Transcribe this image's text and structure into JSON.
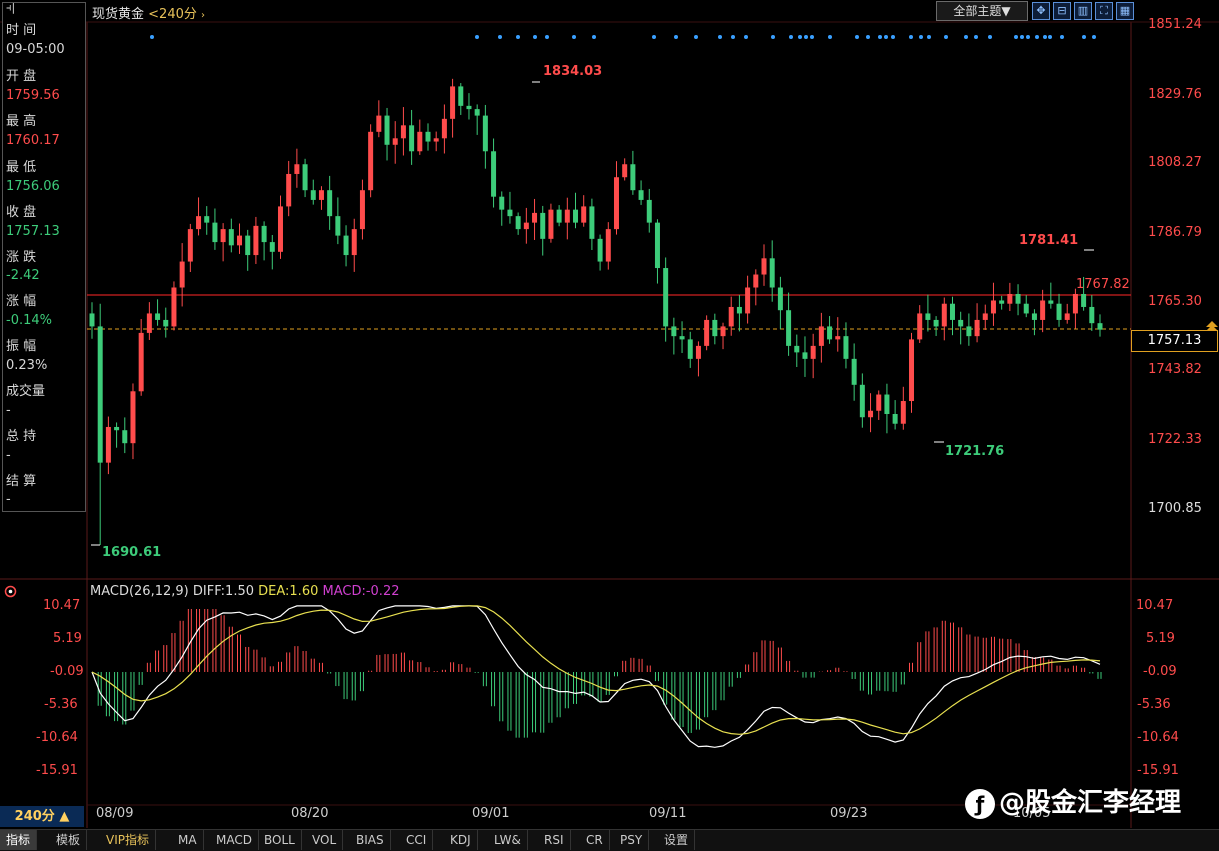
{
  "header": {
    "symbol": "现货黄金",
    "period": "<240分",
    "dropdown_arrow": "›",
    "theme_dropdown": "全部主题▼",
    "tools": [
      "move-icon",
      "chart-icon",
      "split-icon",
      "fullscreen-icon",
      "grid-icon"
    ]
  },
  "info_panel": {
    "time_label": "时 间",
    "time_value": "09-05:00",
    "open_label": "开 盘",
    "open_value": "1759.56",
    "high_label": "最 高",
    "high_value": "1760.17",
    "low_label": "最 低",
    "low_value": "1756.06",
    "close_label": "收 盘",
    "close_value": "1757.13",
    "change_label": "涨 跌",
    "change_value": "-2.42",
    "pct_label": "涨 幅",
    "pct_value": "-0.14%",
    "amp_label": "振 幅",
    "amp_value": "0.23%",
    "vol_label": "成交量",
    "vol_value": "-",
    "oi_label": "总 持",
    "oi_value": "-",
    "settle_label": "结 算",
    "settle_value": "-"
  },
  "price_axis": [
    "1851.24",
    "1829.76",
    "1808.27",
    "1786.79",
    "1765.30",
    "1743.82",
    "1722.33",
    "1700.85"
  ],
  "current_price": "1757.13",
  "annotations": {
    "high": "1834.03",
    "low_start": "1690.61",
    "low_mid": "1721.76",
    "recent_high": "1781.41",
    "red_line": "1767.82"
  },
  "macd": {
    "label": "MACD(26,12,9)",
    "diff": "DIFF:1.50",
    "dea": "DEA:1.60",
    "macd": "MACD:-0.22",
    "axis": [
      "10.47",
      "5.19",
      "-0.09",
      "-5.36",
      "-10.64",
      "-15.91"
    ]
  },
  "dates": [
    "08/09",
    "08/20",
    "09/01",
    "09/11",
    "09/23",
    "10/05"
  ],
  "period_button": "240分 ▲",
  "tabs": [
    "指标",
    "模板",
    "VIP指标",
    "MA",
    "MACD",
    "BOLL",
    "VOL",
    "BIAS",
    "CCI",
    "KDJ",
    "LW&",
    "RSI",
    "CR",
    "PSY",
    "设置"
  ],
  "watermark": "@股金汇李经理",
  "colors": {
    "up": "#ff4c4c",
    "down": "#3dcc7a",
    "dif": "#ffffff",
    "dea": "#e8e050"
  },
  "chart_data": {
    "type": "candlestick",
    "title": "现货黄金 240分",
    "ylim": [
      1690.61,
      1851.24
    ],
    "series": [
      {
        "name": "close",
        "values": [
          1758,
          1716,
          1727,
          1726,
          1722,
          1738,
          1756,
          1762,
          1760,
          1758,
          1770,
          1778,
          1788,
          1792,
          1790,
          1784,
          1788,
          1783,
          1786,
          1780,
          1789,
          1784,
          1781,
          1795,
          1805,
          1808,
          1800,
          1797,
          1800,
          1792,
          1786,
          1780,
          1788,
          1800,
          1818,
          1823,
          1814,
          1816,
          1820,
          1812,
          1818,
          1815,
          1816,
          1822,
          1832,
          1826,
          1825,
          1823,
          1812,
          1798,
          1794,
          1792,
          1788,
          1790,
          1793,
          1785,
          1794,
          1790,
          1794,
          1790,
          1795,
          1785,
          1778,
          1788,
          1804,
          1808,
          1800,
          1797,
          1790,
          1776,
          1758,
          1755,
          1754,
          1748,
          1752,
          1760,
          1755,
          1758,
          1764,
          1762,
          1770,
          1774,
          1779,
          1770,
          1763,
          1752,
          1750,
          1748,
          1752,
          1758,
          1754,
          1755,
          1748,
          1740,
          1730,
          1732,
          1737,
          1731,
          1728,
          1735,
          1754,
          1762,
          1760,
          1758,
          1765,
          1760,
          1758,
          1755,
          1760,
          1762,
          1766,
          1765,
          1768,
          1765,
          1762,
          1760,
          1766,
          1765,
          1760,
          1762,
          1768,
          1764,
          1759,
          1757
        ]
      }
    ]
  }
}
